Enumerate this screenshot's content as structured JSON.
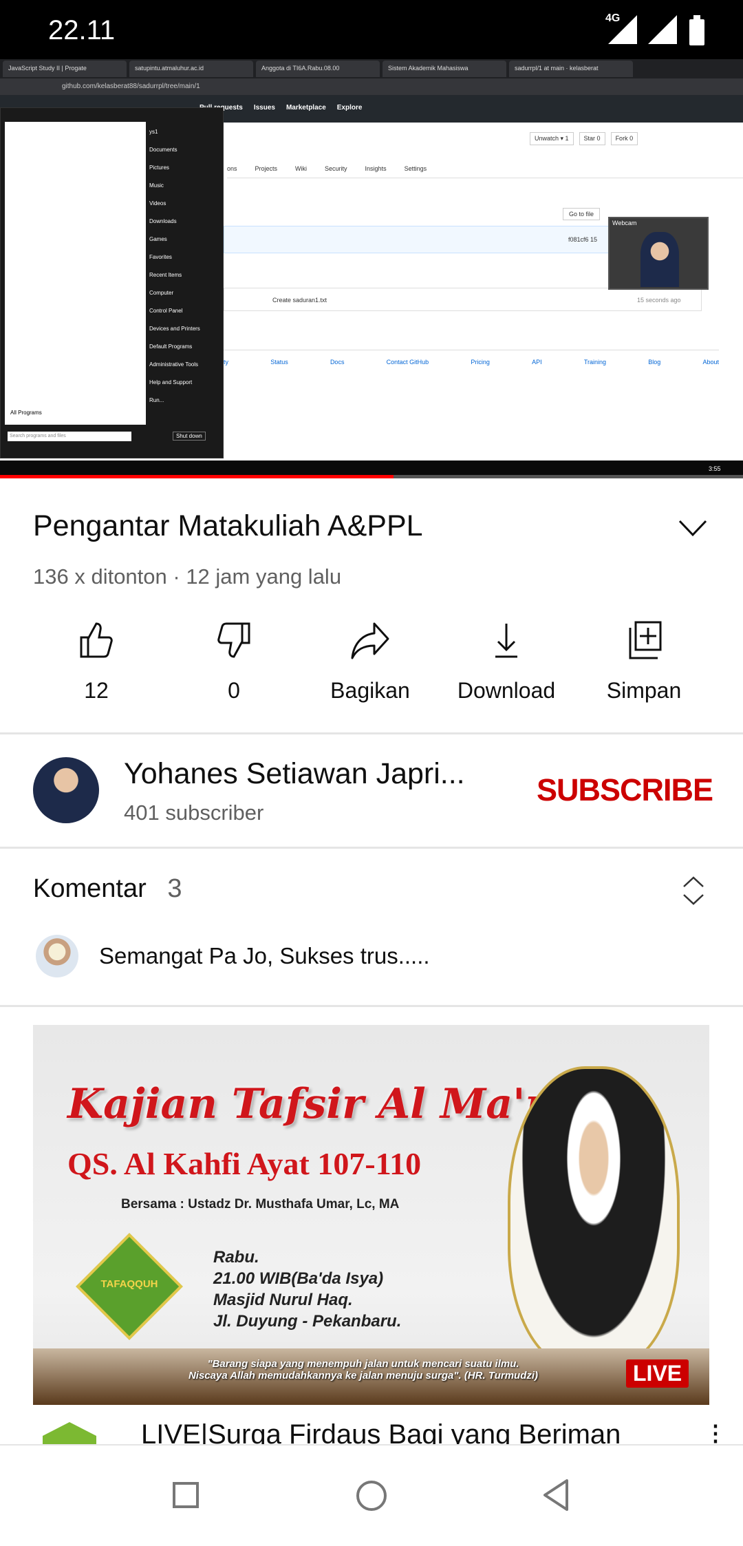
{
  "status_bar": {
    "time": "22.11",
    "network": "4G"
  },
  "video": {
    "progress_percent": 53,
    "browser_tabs": [
      "JavaScript Study II | Progate",
      "satupintu.atmaluhur.ac.id",
      "Anggota di TI6A.Rabu.08.00",
      "Sistem Akademik Mahasiswa",
      "sadurrpl/1 at main · kelasberat"
    ],
    "url": "github.com/kelasberat88/sadurrpl/tree/main/1",
    "github_nav": [
      "Pull requests",
      "Issues",
      "Marketplace",
      "Explore"
    ],
    "repo_tabs": [
      "ons",
      "Projects",
      "Wiki",
      "Security",
      "Insights",
      "Settings"
    ],
    "repo_buttons": [
      "Unwatch ▾ 1",
      "Star 0",
      "Fork 0"
    ],
    "go_to_file": "Go to file",
    "commit_hash": "f081cf6 15",
    "file_row": "Create saduran1.txt",
    "file_time": "15 seconds ago",
    "footer_links": [
      "ty",
      "Status",
      "Docs",
      "Contact GitHub",
      "Pricing",
      "API",
      "Training",
      "Blog",
      "About"
    ],
    "webcam_label": "Webcam",
    "start_menu": [
      "ys1",
      "Documents",
      "Pictures",
      "Music",
      "Videos",
      "Downloads",
      "Games",
      "Favorites",
      "Recent Items",
      "Computer",
      "Control Panel",
      "Devices and Printers",
      "Default Programs",
      "Administrative Tools",
      "Help and Support",
      "Run..."
    ],
    "all_programs": "All Programs",
    "search_placeholder": "Search programs and files",
    "shutdown": "Shut down",
    "clock": "3:55"
  },
  "title": "Pengantar Matakuliah A&PPL",
  "meta": "136 x ditonton · 12 jam yang lalu",
  "actions": [
    {
      "icon": "thumbs-up-icon",
      "label": "12"
    },
    {
      "icon": "thumbs-down-icon",
      "label": "0"
    },
    {
      "icon": "share-icon",
      "label": "Bagikan"
    },
    {
      "icon": "download-icon",
      "label": "Download"
    },
    {
      "icon": "save-playlist-icon",
      "label": "Simpan"
    }
  ],
  "channel": {
    "name": "Yohanes Setiawan Japri...",
    "subscribers": "401 subscriber",
    "subscribe_label": "SUBSCRIBE"
  },
  "comments": {
    "label": "Komentar",
    "count": "3",
    "top_comment": "Semangat Pa Jo, Sukses trus....."
  },
  "next_video": {
    "title": "LIVE|Surga Firdaus Bagi yang Beriman",
    "badge": "LIVE",
    "thumb": {
      "script_title": "Kajian Tafsir Al Ma'rifah",
      "subtitle": "QS. Al Kahfi Ayat 107-110",
      "speaker": "Bersama :  Ustadz Dr. Musthafa Umar, Lc, MA",
      "details": [
        "Rabu.",
        "21.00 WIB(Ba'da Isya)",
        "Masjid Nurul Haq.",
        "Jl. Duyung - Pekanbaru."
      ],
      "logo": "TAFAQQUH",
      "quote1": "\"Barang siapa yang menempuh jalan untuk mencari suatu ilmu.",
      "quote2": "Niscaya Allah memudahkannya ke jalan menuju surga\". (HR. Turmudzi)"
    }
  },
  "colors": {
    "accent": "#cc0000",
    "progress": "#ff0000",
    "secondary_text": "#606060"
  }
}
